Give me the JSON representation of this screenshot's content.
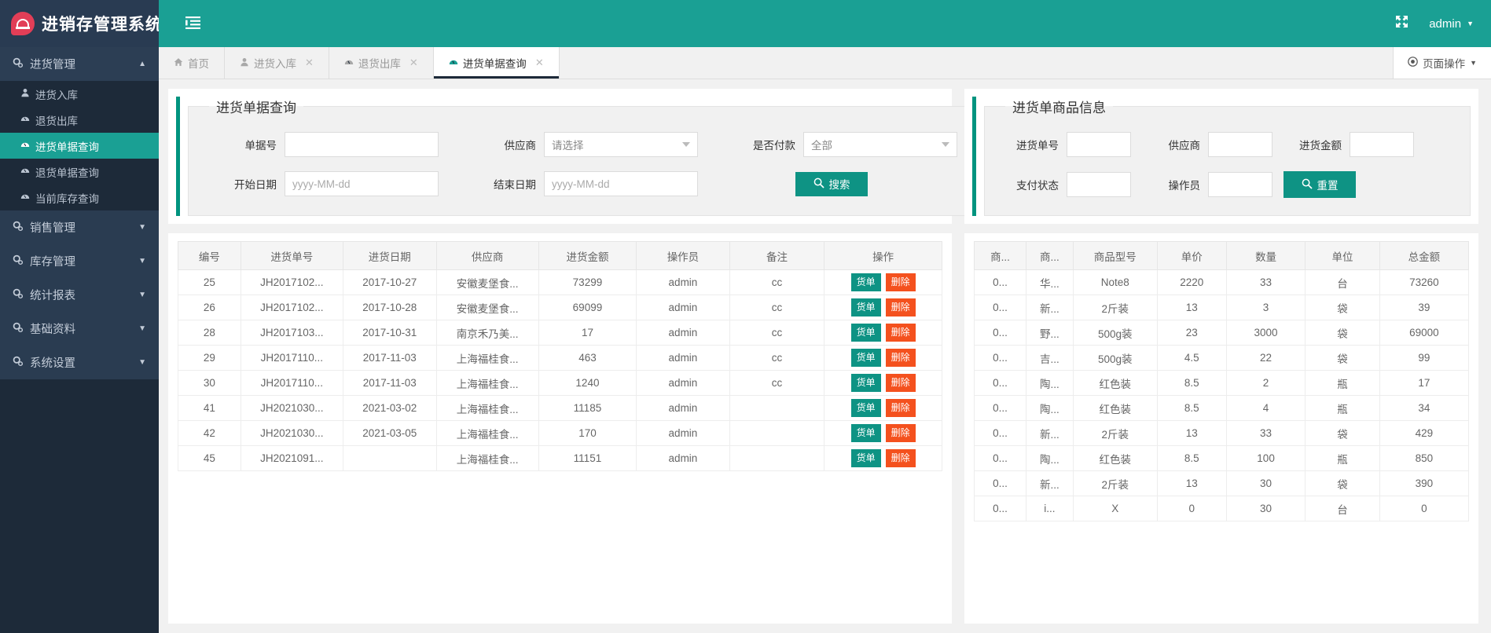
{
  "brand": {
    "title": "进销存管理系统",
    "logo_icon": "speedometer-logo-icon"
  },
  "topbar": {
    "menu_toggle_icon": "menu-indent-icon",
    "fullscreen_icon": "fullscreen-icon",
    "user": "admin",
    "user_caret": "▼"
  },
  "sidebar": {
    "groups": [
      {
        "label": "进货管理",
        "icon": "gears-icon",
        "caret": "▲",
        "expanded": true,
        "items": [
          {
            "label": "进货入库",
            "icon": "user-icon",
            "active": false
          },
          {
            "label": "退货出库",
            "icon": "dashboard-icon",
            "active": false
          },
          {
            "label": "进货单据查询",
            "icon": "dashboard-icon",
            "active": true
          },
          {
            "label": "退货单据查询",
            "icon": "dashboard-icon",
            "active": false
          },
          {
            "label": "当前库存查询",
            "icon": "dashboard-icon",
            "active": false
          }
        ]
      },
      {
        "label": "销售管理",
        "icon": "gears-icon",
        "caret": "▼",
        "expanded": false,
        "items": []
      },
      {
        "label": "库存管理",
        "icon": "gears-icon",
        "caret": "▼",
        "expanded": false,
        "items": []
      },
      {
        "label": "统计报表",
        "icon": "gears-icon",
        "caret": "▼",
        "expanded": false,
        "items": []
      },
      {
        "label": "基础资料",
        "icon": "gears-icon",
        "caret": "▼",
        "expanded": false,
        "items": []
      },
      {
        "label": "系统设置",
        "icon": "gears-icon",
        "caret": "▼",
        "expanded": false,
        "items": []
      }
    ]
  },
  "tabs": {
    "items": [
      {
        "label": "首页",
        "icon": "home-icon",
        "closable": false,
        "active": false
      },
      {
        "label": "进货入库",
        "icon": "user-icon",
        "closable": true,
        "active": false
      },
      {
        "label": "退货出库",
        "icon": "dashboard-icon",
        "closable": true,
        "active": false
      },
      {
        "label": "进货单据查询",
        "icon": "dashboard-icon",
        "closable": true,
        "active": true
      }
    ],
    "close_glyph": "✕",
    "page_ops": {
      "label": "页面操作",
      "icon": "target-icon",
      "caret": "▼"
    }
  },
  "search_panel": {
    "legend": "进货单据查询",
    "fields": {
      "doc_no_label": "单据号",
      "doc_no_value": "",
      "supplier_label": "供应商",
      "supplier_value": "请选择",
      "paid_label": "是否付款",
      "paid_value": "全部",
      "start_date_label": "开始日期",
      "start_date_placeholder": "yyyy-MM-dd",
      "start_date_value": "",
      "end_date_label": "结束日期",
      "end_date_placeholder": "yyyy-MM-dd",
      "end_date_value": ""
    },
    "search_button": {
      "label": "搜索",
      "icon": "search-icon"
    }
  },
  "detail_panel": {
    "legend": "进货单商品信息",
    "fields": {
      "order_no_label": "进货单号",
      "order_no_value": "",
      "supplier_label": "供应商",
      "supplier_value": "",
      "amount_label": "进货金额",
      "amount_value": "",
      "pay_status_label": "支付状态",
      "pay_status_value": "",
      "operator_label": "操作员",
      "operator_value": ""
    },
    "reset_button": {
      "label": "重置",
      "icon": "search-icon"
    }
  },
  "orders_table": {
    "columns": [
      "编号",
      "进货单号",
      "进货日期",
      "供应商",
      "进货金额",
      "操作员",
      "备注",
      "操作"
    ],
    "row_actions": {
      "view_label": "货单",
      "delete_label": "删除"
    },
    "rows": [
      {
        "id": "25",
        "order_no": "JH2017102...",
        "date": "2017-10-27",
        "supplier": "安徽麦堡食...",
        "amount": "73299",
        "operator": "admin",
        "remark": "cc"
      },
      {
        "id": "26",
        "order_no": "JH2017102...",
        "date": "2017-10-28",
        "supplier": "安徽麦堡食...",
        "amount": "69099",
        "operator": "admin",
        "remark": "cc"
      },
      {
        "id": "28",
        "order_no": "JH2017103...",
        "date": "2017-10-31",
        "supplier": "南京禾乃美...",
        "amount": "17",
        "operator": "admin",
        "remark": "cc"
      },
      {
        "id": "29",
        "order_no": "JH2017110...",
        "date": "2017-11-03",
        "supplier": "上海福桂食...",
        "amount": "463",
        "operator": "admin",
        "remark": "cc"
      },
      {
        "id": "30",
        "order_no": "JH2017110...",
        "date": "2017-11-03",
        "supplier": "上海福桂食...",
        "amount": "1240",
        "operator": "admin",
        "remark": "cc"
      },
      {
        "id": "41",
        "order_no": "JH2021030...",
        "date": "2021-03-02",
        "supplier": "上海福桂食...",
        "amount": "11185",
        "operator": "admin",
        "remark": ""
      },
      {
        "id": "42",
        "order_no": "JH2021030...",
        "date": "2021-03-05",
        "supplier": "上海福桂食...",
        "amount": "170",
        "operator": "admin",
        "remark": ""
      },
      {
        "id": "45",
        "order_no": "JH2021091...",
        "date": "",
        "supplier": "上海福桂食...",
        "amount": "11151",
        "operator": "admin",
        "remark": ""
      }
    ]
  },
  "goods_table": {
    "columns": [
      "商...",
      "商...",
      "商品型号",
      "单价",
      "数量",
      "单位",
      "总金额"
    ],
    "rows": [
      {
        "c0": "0...",
        "c1": "华...",
        "model": "Note8",
        "price": "2220",
        "qty": "33",
        "unit": "台",
        "total": "73260"
      },
      {
        "c0": "0...",
        "c1": "新...",
        "model": "2斤装",
        "price": "13",
        "qty": "3",
        "unit": "袋",
        "total": "39"
      },
      {
        "c0": "0...",
        "c1": "野...",
        "model": "500g装",
        "price": "23",
        "qty": "3000",
        "unit": "袋",
        "total": "69000"
      },
      {
        "c0": "0...",
        "c1": "吉...",
        "model": "500g装",
        "price": "4.5",
        "qty": "22",
        "unit": "袋",
        "total": "99"
      },
      {
        "c0": "0...",
        "c1": "陶...",
        "model": "红色装",
        "price": "8.5",
        "qty": "2",
        "unit": "瓶",
        "total": "17"
      },
      {
        "c0": "0...",
        "c1": "陶...",
        "model": "红色装",
        "price": "8.5",
        "qty": "4",
        "unit": "瓶",
        "total": "34"
      },
      {
        "c0": "0...",
        "c1": "新...",
        "model": "2斤装",
        "price": "13",
        "qty": "33",
        "unit": "袋",
        "total": "429"
      },
      {
        "c0": "0...",
        "c1": "陶...",
        "model": "红色装",
        "price": "8.5",
        "qty": "100",
        "unit": "瓶",
        "total": "850"
      },
      {
        "c0": "0...",
        "c1": "新...",
        "model": "2斤装",
        "price": "13",
        "qty": "30",
        "unit": "袋",
        "total": "390"
      },
      {
        "c0": "0...",
        "c1": "i...",
        "model": "X",
        "price": "0",
        "qty": "30",
        "unit": "台",
        "total": "0"
      }
    ]
  },
  "colors": {
    "brand_teal": "#1aa094",
    "sidebar_dark": "#1d2a39",
    "sidebar_group": "#2c3e54",
    "accent_green": "#00947f",
    "delete_orange": "#f4511e",
    "logo_red": "#e23e57"
  }
}
